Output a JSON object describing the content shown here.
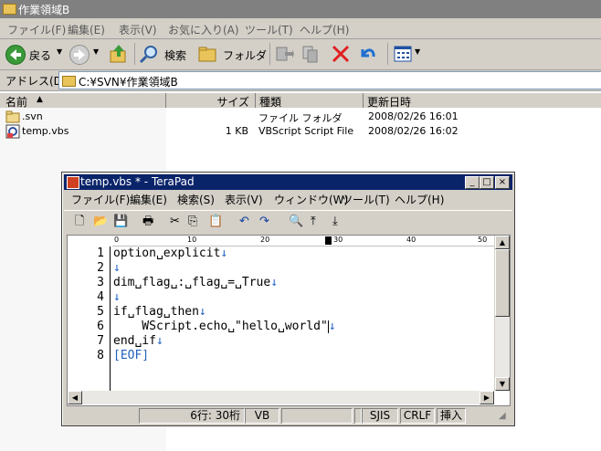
{
  "explorer": {
    "title": "作業領域B",
    "menu": [
      "ファイル(F)",
      "編集(E)",
      "表示(V)",
      "お気に入り(A)",
      "ツール(T)",
      "ヘルプ(H)"
    ],
    "toolbar": {
      "back_label": "戻る",
      "search_label": "検索",
      "folders_label": "フォルダ"
    },
    "address_label": "アドレス(D)",
    "address_value": "C:¥SVN¥作業領域B",
    "columns": [
      "名前",
      "サイズ",
      "種類",
      "更新日時"
    ],
    "files": [
      {
        "name": ".svn",
        "size": "",
        "type": "ファイル フォルダ",
        "modified": "2008/02/26 16:01"
      },
      {
        "name": "temp.vbs",
        "size": "1 KB",
        "type": "VBScript Script File",
        "modified": "2008/02/26 16:02"
      }
    ]
  },
  "terapad": {
    "title": "temp.vbs * - TeraPad",
    "menu": [
      "ファイル(F)",
      "編集(E)",
      "検索(S)",
      "表示(V)",
      "ウィンドウ(W)",
      "ツール(T)",
      "ヘルプ(H)"
    ],
    "ruler": [
      "0",
      "10",
      "20",
      "30",
      "40",
      "50"
    ],
    "line_numbers": [
      "1",
      "2",
      "3",
      "4",
      "5",
      "6",
      "7",
      "8"
    ],
    "code": [
      "option␣explicit",
      "",
      "dim␣flag␣:␣flag␣=␣True",
      "",
      "if␣flag␣then",
      "    WScript.echo␣\"hello␣world\"",
      "end␣if",
      "[EOF]"
    ],
    "status": {
      "position": "6行:  30桁",
      "mode": "VB",
      "encoding": "SJIS",
      "newline": "CRLF",
      "insert": "挿入"
    }
  },
  "colors": {
    "explorer_titlebar": "#808080",
    "terapad_titlebar": "#0a246a",
    "eol_mark": "#2060c0"
  }
}
